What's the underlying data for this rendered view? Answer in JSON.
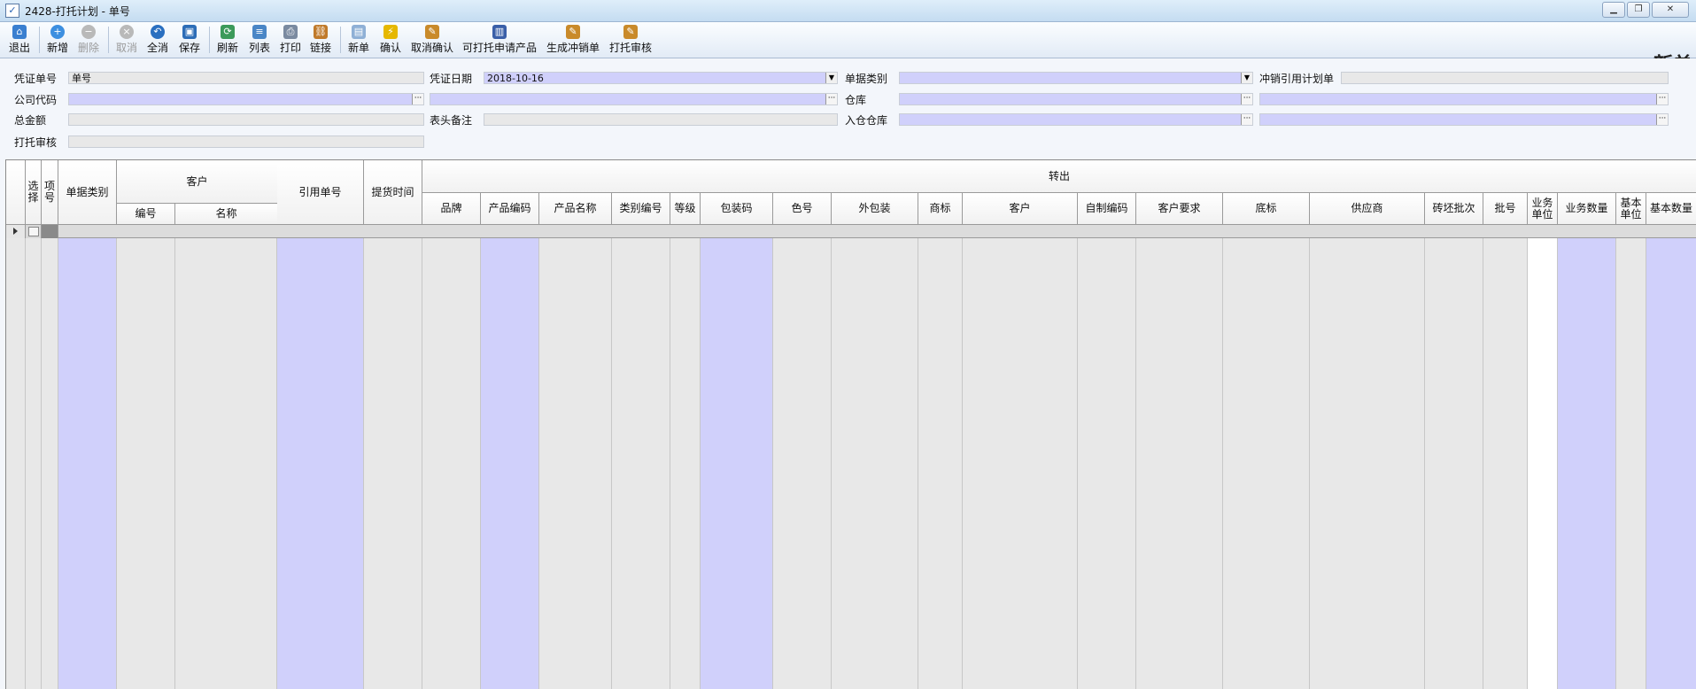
{
  "window": {
    "title": "2428-打托计划 - 单号",
    "app_icon": "checkmark-doc-icon",
    "controls": [
      "minimize",
      "restore",
      "close"
    ]
  },
  "toolbar": {
    "buttons": [
      {
        "label": "退出",
        "icon": "home-icon",
        "enabled": true
      },
      {
        "label": "新增",
        "icon": "add-circle-icon",
        "enabled": true
      },
      {
        "label": "删除",
        "icon": "remove-circle-icon",
        "enabled": false
      },
      {
        "label": "取消",
        "icon": "cancel-circle-icon",
        "enabled": false
      },
      {
        "label": "全消",
        "icon": "undo-icon",
        "enabled": true
      },
      {
        "label": "保存",
        "icon": "floppy-icon",
        "enabled": true
      },
      {
        "label": "刷新",
        "icon": "refresh-icon",
        "enabled": true
      },
      {
        "label": "列表",
        "icon": "list-icon",
        "enabled": true
      },
      {
        "label": "打印",
        "icon": "printer-icon",
        "enabled": true
      },
      {
        "label": "链接",
        "icon": "link-icon",
        "enabled": true
      },
      {
        "label": "新单",
        "icon": "new-doc-icon",
        "enabled": true
      },
      {
        "label": "确认",
        "icon": "lightning-icon",
        "enabled": true
      },
      {
        "label": "取消确认",
        "icon": "doc-cancel-icon",
        "enabled": true
      },
      {
        "label": "可打托申请产品",
        "icon": "book-icon",
        "enabled": true
      },
      {
        "label": "生成冲销单",
        "icon": "doc-generate-icon",
        "enabled": true
      },
      {
        "label": "打托审核",
        "icon": "doc-audit-icon",
        "enabled": true
      }
    ],
    "mode_title": "新单"
  },
  "form": {
    "voucher_no_label": "凭证单号",
    "voucher_no_value": "单号",
    "voucher_date_label": "凭证日期",
    "voucher_date_value": "2018-10-16",
    "doc_type_label": "单据类别",
    "doc_type_value": "",
    "offset_ref_label": "冲销引用计划单",
    "offset_ref_value": "",
    "company_code_label": "公司代码",
    "company_code_value": "",
    "company_name_value": "",
    "warehouse_label": "仓库",
    "warehouse_code_value": "",
    "warehouse_name_value": "",
    "total_amount_label": "总金额",
    "total_amount_value": "",
    "header_remark_label": "表头备注",
    "header_remark_value": "",
    "in_warehouse_label": "入仓仓库",
    "in_warehouse_code_value": "",
    "in_warehouse_name_value": "",
    "pallet_audit_label": "打托审核",
    "pallet_audit_value": ""
  },
  "grid": {
    "group_headers": {
      "customer": "客户",
      "transfer_out": "转出"
    },
    "columns": {
      "select": "选择",
      "item_no": "项号",
      "doc_type": "单据类别",
      "cust_code": "编号",
      "cust_name": "名称",
      "ref_no": "引用单号",
      "pickup_time": "提货时间",
      "brand": "品牌",
      "product_code": "产品编码",
      "product_name": "产品名称",
      "category_code": "类别编号",
      "grade": "等级",
      "package_code": "包装码",
      "color_no": "色号",
      "outer_pack": "外包装",
      "trademark": "商标",
      "customer": "客户",
      "self_code": "自制编码",
      "cust_req": "客户要求",
      "base_mark": "底标",
      "supplier": "供应商",
      "brick_batch": "砖坯批次",
      "batch_no": "批号",
      "biz_unit": "业务单位",
      "biz_qty": "业务数量",
      "base_unit": "基本单位",
      "base_qty": "基本数量"
    }
  },
  "colors": {
    "editable_purple": "#d0d0fb",
    "readonly_gray": "#e8e8e8"
  }
}
